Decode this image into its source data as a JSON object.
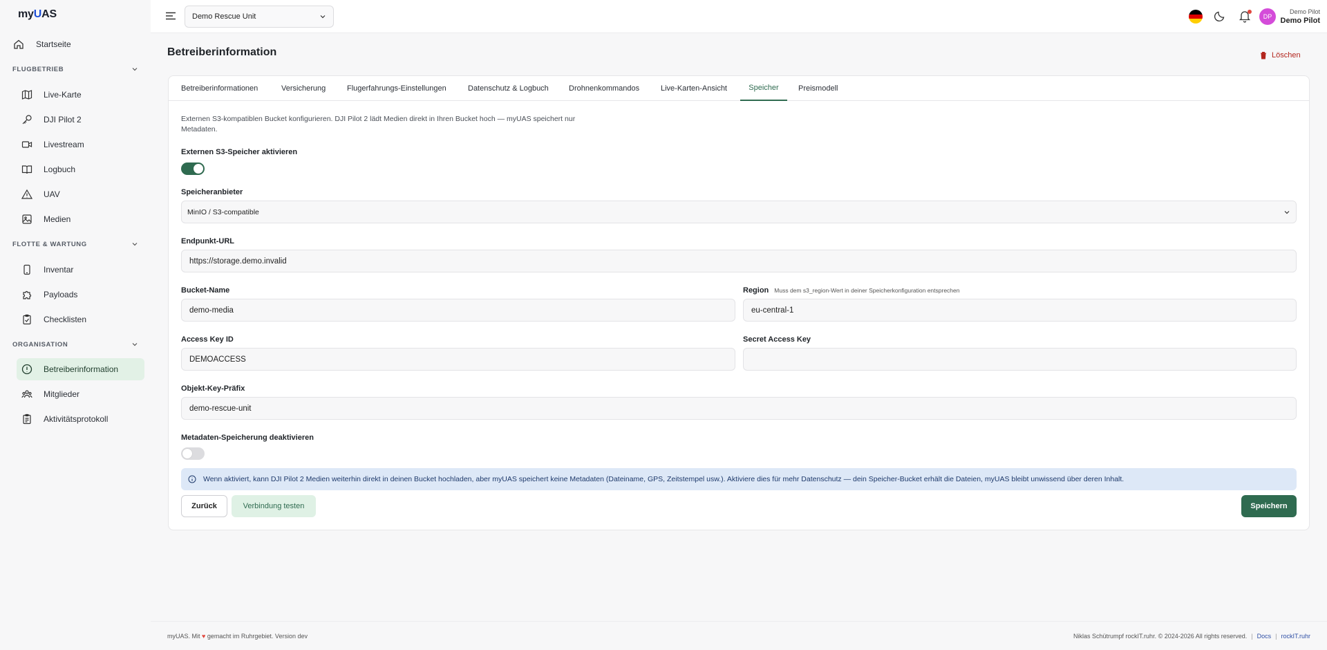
{
  "app": {
    "logo": "myUAS"
  },
  "sidebar": {
    "home": "Startseite",
    "sections": [
      {
        "title": "FLUGBETRIEB",
        "items": [
          "Live-Karte",
          "DJI Pilot 2",
          "Livestream",
          "Logbuch",
          "UAV",
          "Medien"
        ]
      },
      {
        "title": "FLOTTE & WARTUNG",
        "items": [
          "Inventar",
          "Payloads",
          "Checklisten"
        ]
      },
      {
        "title": "ORGANISATION",
        "items": [
          "Betreiberinformation",
          "Mitglieder",
          "Aktivitätsprotokoll"
        ]
      }
    ],
    "active_item": "Betreiberinformation"
  },
  "header": {
    "unit_select": "Demo Rescue Unit",
    "avatar_initials": "DP",
    "user_role": "Demo Pilot",
    "user_name": "Demo Pilot"
  },
  "page": {
    "title": "Betreiberinformation",
    "delete_label": "Löschen"
  },
  "tabs": [
    "Betreiberinformationen",
    "Versicherung",
    "Flugerfahrungs-Einstellungen",
    "Datenschutz & Logbuch",
    "Drohnenkommandos",
    "Live-Karten-Ansicht",
    "Speicher",
    "Preismodell"
  ],
  "active_tab": "Speicher",
  "form": {
    "description": "Externen S3-kompatiblen Bucket konfigurieren. DJI Pilot 2 lädt Medien direkt in Ihren Bucket hoch — myUAS speichert nur Metadaten.",
    "enable_label": "Externen S3-Speicher aktivieren",
    "enable_on": true,
    "provider_label": "Speicheranbieter",
    "provider_value": "MinIO / S3-compatible",
    "endpoint_label": "Endpunkt-URL",
    "endpoint_value": "https://storage.demo.invalid",
    "bucket_label": "Bucket-Name",
    "bucket_value": "demo-media",
    "region_label": "Region",
    "region_hint": "Muss dem s3_region-Wert in deiner Speicherkonfiguration entsprechen",
    "region_value": "eu-central-1",
    "access_key_label": "Access Key ID",
    "access_key_value": "DEMOACCESS",
    "secret_label": "Secret Access Key",
    "secret_value": "",
    "prefix_label": "Objekt-Key-Präfix",
    "prefix_value": "demo-rescue-unit",
    "metadata_label": "Metadaten-Speicherung deaktivieren",
    "metadata_on": false,
    "info_text": "Wenn aktiviert, kann DJI Pilot 2 Medien weiterhin direkt in deinen Bucket hochladen, aber myUAS speichert keine Metadaten (Dateiname, GPS, Zeitstempel usw.). Aktiviere dies für mehr Datenschutz — dein Speicher-Bucket erhält die Dateien, myUAS bleibt unwissend über deren Inhalt.",
    "back_label": "Zurück",
    "test_label": "Verbindung testen",
    "save_label": "Speichern"
  },
  "footer": {
    "left_prefix": "myUAS. Mit",
    "left_suffix": "gemacht im Ruhrgebiet. Version dev",
    "right_text": "Niklas Schütrumpf rockIT.ruhr. © 2024-2026 All rights reserved.",
    "docs": "Docs",
    "site": "rockIT.ruhr"
  },
  "colors": {
    "accent": "#2f6b50",
    "danger": "#b3261e",
    "info_bg": "#dde8f7",
    "avatar": "#d44cd9"
  }
}
